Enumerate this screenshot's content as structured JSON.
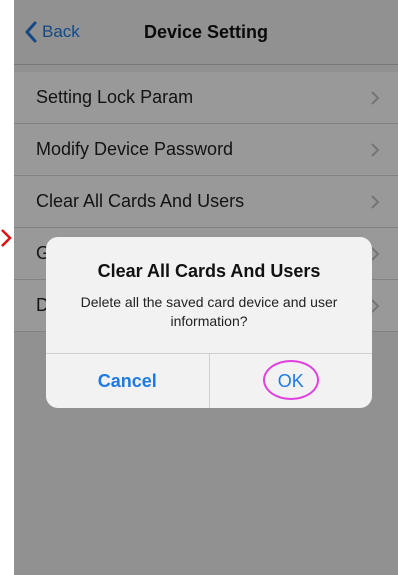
{
  "navbar": {
    "back_label": "Back",
    "title": "Device Setting"
  },
  "settings": {
    "items": [
      {
        "label": "Setting Lock Param"
      },
      {
        "label": "Modify Device Password"
      },
      {
        "label": "Clear All Cards And Users"
      },
      {
        "label": "G"
      },
      {
        "label": "D"
      }
    ]
  },
  "alert": {
    "title": "Clear All Cards And Users",
    "message": "Delete all the saved card device and user information?",
    "cancel_label": "Cancel",
    "ok_label": "OK"
  },
  "colors": {
    "accent": "#1f7ae0",
    "highlight_ring": "#e040e0",
    "marker": "#e01010"
  }
}
